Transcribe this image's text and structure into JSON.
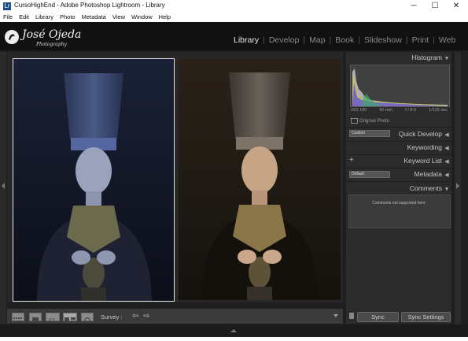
{
  "window": {
    "title": "CursoHighEnd - Adobe Photoshop Lightroom - Library",
    "icon": "Lr",
    "controls": [
      "─",
      "☐",
      "✕"
    ]
  },
  "menu": [
    "File",
    "Edit",
    "Library",
    "Photo",
    "Metadata",
    "View",
    "Window",
    "Help"
  ],
  "identity": {
    "name": "José Ojeda",
    "subtitle": "Photography"
  },
  "modules": [
    {
      "label": "Library",
      "active": true
    },
    {
      "label": "Develop"
    },
    {
      "label": "Map"
    },
    {
      "label": "Book"
    },
    {
      "label": "Slideshow"
    },
    {
      "label": "Print"
    },
    {
      "label": "Web"
    }
  ],
  "panels": {
    "histogram": "Histogram",
    "histogram_info": [
      "ISO 100",
      "50 mm",
      "f / 8.0",
      "1/125 sec"
    ],
    "original_photo": "Original Photo",
    "quick_develop": "Quick Develop",
    "quick_develop_preset": "Custom",
    "keywording": "Keywording",
    "keyword_list": "Keyword List",
    "metadata": "Metadata",
    "metadata_preset": "Default",
    "comments": "Comments",
    "comments_text": "Comments not supported here"
  },
  "toolbar": {
    "survey_label": "Survey :"
  },
  "sync": {
    "sync_label": "Sync",
    "sync_settings_label": "Sync Settings"
  },
  "colors": {
    "lr_bg": "#1f1f1f",
    "accent_active": "#e9e9e9"
  }
}
